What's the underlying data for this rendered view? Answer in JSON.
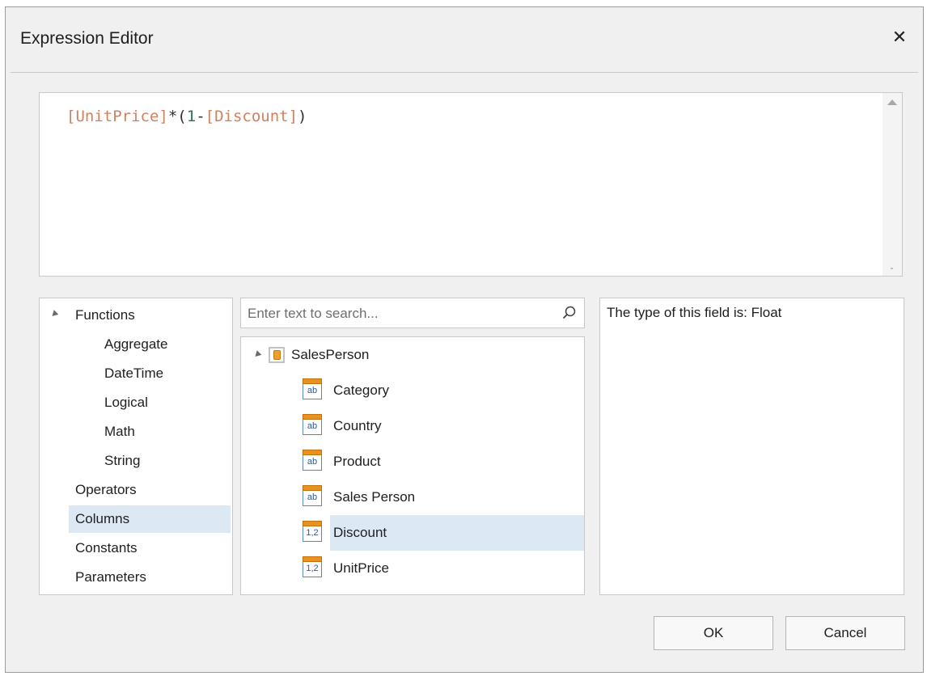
{
  "window": {
    "title": "Expression Editor",
    "close_label": "✕"
  },
  "expression": {
    "tokens": [
      {
        "text": "[UnitPrice]",
        "kind": "field"
      },
      {
        "text": "*(",
        "kind": "op"
      },
      {
        "text": "1",
        "kind": "num"
      },
      {
        "text": "-",
        "kind": "op"
      },
      {
        "text": "[Discount]",
        "kind": "field"
      },
      {
        "text": ")",
        "kind": "op"
      }
    ],
    "colors": {
      "field": "#d08060",
      "op": "#303030",
      "num": "#1f7a5a"
    }
  },
  "categories": {
    "functions_label": "Functions",
    "function_items": [
      "Aggregate",
      "DateTime",
      "Logical",
      "Math",
      "String"
    ],
    "operators": "Operators",
    "columns": "Columns",
    "constants": "Constants",
    "parameters": "Parameters",
    "selected": "Columns"
  },
  "search": {
    "placeholder": "Enter text to search...",
    "value": ""
  },
  "tree": {
    "root": "SalesPerson",
    "columns": [
      {
        "label": "Category",
        "type_icon": "ab"
      },
      {
        "label": "Country",
        "type_icon": "ab"
      },
      {
        "label": "Product",
        "type_icon": "ab"
      },
      {
        "label": "Sales Person",
        "type_icon": "ab"
      },
      {
        "label": "Discount",
        "type_icon": "1,2"
      },
      {
        "label": "UnitPrice",
        "type_icon": "1,2"
      }
    ],
    "selected": "Discount"
  },
  "description": {
    "text": "The type of this field is: Float"
  },
  "buttons": {
    "ok": "OK",
    "cancel": "Cancel"
  },
  "accent": {
    "selection": "#dde8f5"
  }
}
